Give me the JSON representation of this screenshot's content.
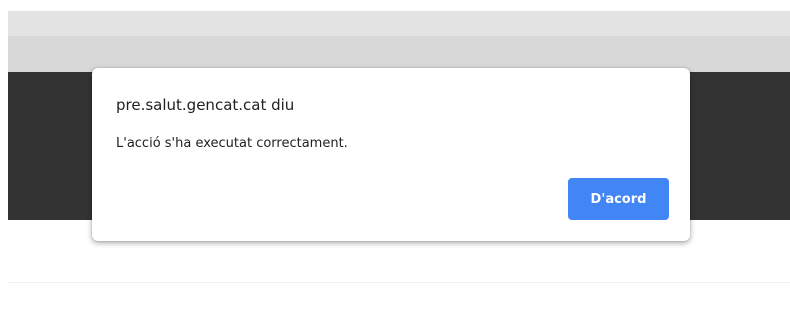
{
  "dialog": {
    "title": "pre.salut.gencat.cat diu",
    "message": "L'acció s'ha executat correctament.",
    "ok_label": "D'acord"
  },
  "colors": {
    "button_accent": "#4285f4",
    "backdrop_dark": "#333333",
    "backdrop_gray": "#d8d8d8"
  }
}
